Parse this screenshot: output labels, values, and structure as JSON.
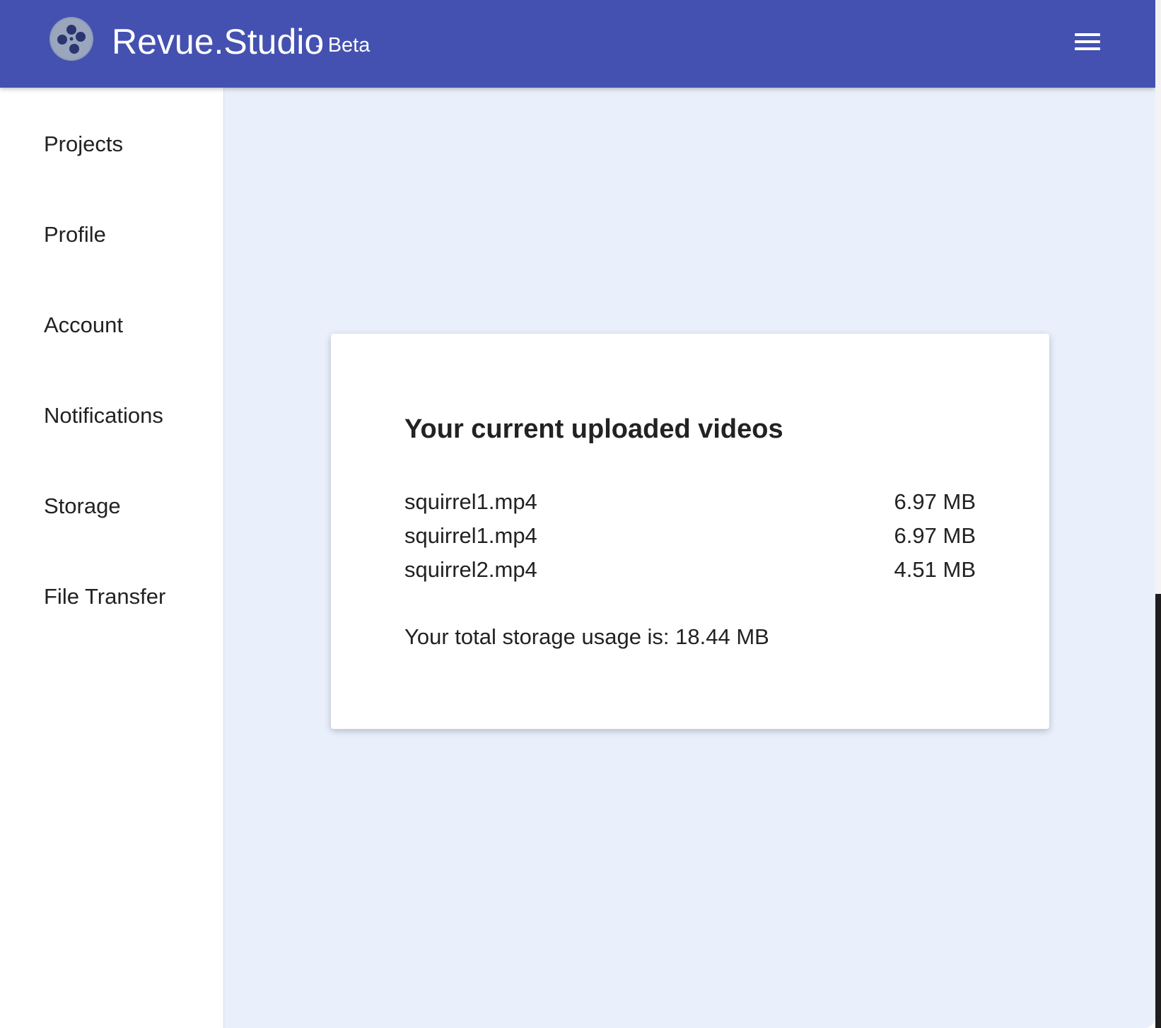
{
  "header": {
    "brand": "Revue.Studio",
    "badge": "- Beta",
    "logo_icon": "film-reel-icon",
    "menu_icon": "hamburger-menu-icon",
    "background_color": "#4451b0"
  },
  "sidebar": {
    "items": [
      {
        "label": "Projects"
      },
      {
        "label": "Profile"
      },
      {
        "label": "Account"
      },
      {
        "label": "Notifications"
      },
      {
        "label": "Storage"
      },
      {
        "label": "File Transfer"
      }
    ]
  },
  "storage": {
    "title": "Your current uploaded videos",
    "files": [
      {
        "name": "squirrel1.mp4",
        "size": "6.97 MB"
      },
      {
        "name": "squirrel1.mp4",
        "size": "6.97 MB"
      },
      {
        "name": "squirrel2.mp4",
        "size": "4.51 MB"
      }
    ],
    "total": "Your total storage usage is: 18.44 MB"
  },
  "colors": {
    "content_background": "#e9effb",
    "card_background": "#ffffff",
    "text": "#222222"
  }
}
